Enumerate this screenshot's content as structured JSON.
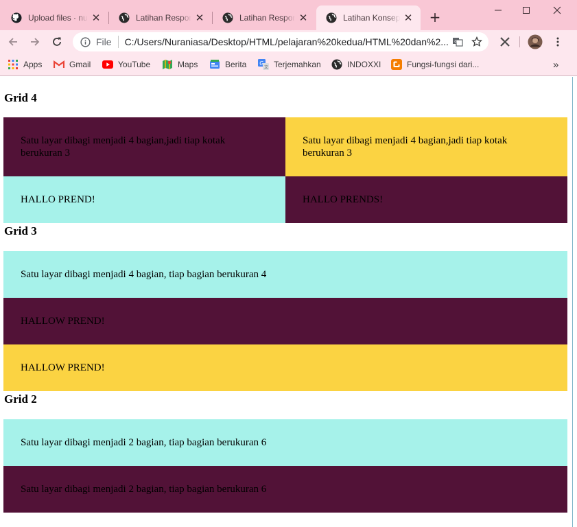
{
  "browser": {
    "tabs": [
      {
        "title": "Upload files · nuraniasa",
        "icon": "github-icon",
        "active": false
      },
      {
        "title": "Latihan Responsive",
        "icon": "globe-icon",
        "active": false
      },
      {
        "title": "Latihan Responsive",
        "icon": "globe-icon",
        "active": false
      },
      {
        "title": "Latihan Konsep Grid",
        "icon": "globe-icon",
        "active": true
      }
    ],
    "new_tab": "+",
    "address": {
      "scheme": "File",
      "url": "C:/Users/Nuraniasa/Desktop/HTML/pelajaran%20kedua/HTML%20dan%2..."
    },
    "bookmarks": [
      {
        "label": "Apps",
        "icon": "apps-grid-icon"
      },
      {
        "label": "Gmail",
        "icon": "gmail-icon"
      },
      {
        "label": "YouTube",
        "icon": "youtube-icon"
      },
      {
        "label": "Maps",
        "icon": "maps-icon"
      },
      {
        "label": "Berita",
        "icon": "news-icon"
      },
      {
        "label": "Terjemahkan",
        "icon": "translate-icon"
      },
      {
        "label": "INDOXXI",
        "icon": "globe-icon"
      },
      {
        "label": "Fungsi-fungsi dari...",
        "icon": "blogger-icon"
      }
    ],
    "bookmarks_overflow": "»"
  },
  "colors": {
    "maroon": "#521237",
    "yellow": "#fbd342",
    "cyan": "#a6f2ea"
  },
  "page": {
    "grid4": {
      "heading": "Grid 4",
      "cells": [
        "Satu layar dibagi menjadi 4 bagian,jadi tiap kotak berukuran 3",
        "Satu layar dibagi menjadi 4 bagian,jadi tiap kotak berukuran 3",
        "HALLO PREND!",
        "HALLO PRENDS!"
      ]
    },
    "grid3": {
      "heading": "Grid 3",
      "cells": [
        "Satu layar dibagi menjadi 4 bagian, tiap bagian berukuran 4",
        "HALLOW PREND!",
        "HALLOW PREND!"
      ]
    },
    "grid2": {
      "heading": "Grid 2",
      "cells": [
        "Satu layar dibagi menjadi 2 bagian, tiap bagian berukuran 6",
        "Satu layar dibagi menjadi 2 bagian, tiap bagian berukuran 6"
      ]
    }
  }
}
